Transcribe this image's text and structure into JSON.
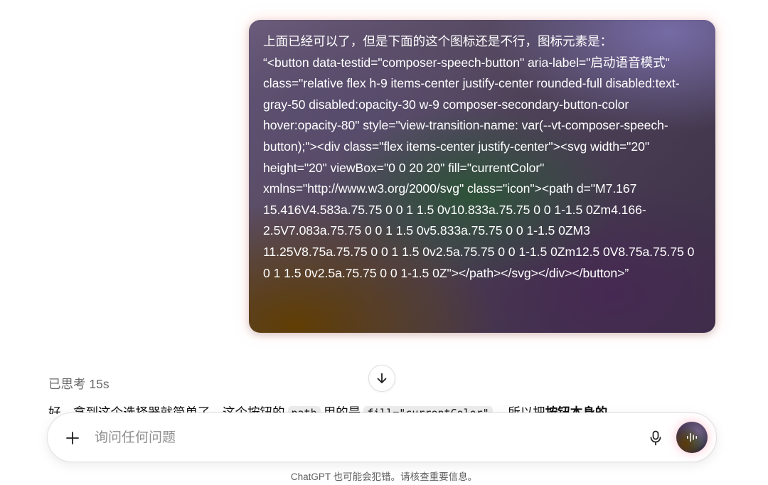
{
  "user_message": {
    "text": "上面已经可以了，但是下面的这个图标还是不行，图标元素是：\n“<button data-testid=\"composer-speech-button\" aria-label=\"启动语音模式\" class=\"relative flex h-9 items-center justify-center rounded-full disabled:text-gray-50 disabled:opacity-30 w-9 composer-secondary-button-color hover:opacity-80\" style=\"view-transition-name: var(--vt-composer-speech-button);\"><div class=\"flex items-center justify-center\"><svg width=\"20\" height=\"20\" viewBox=\"0 0 20 20\" fill=\"currentColor\" xmlns=\"http://www.w3.org/2000/svg\" class=\"icon\"><path d=\"M7.167 15.416V4.583a.75.75 0 0 1 1.5 0v10.833a.75.75 0 0 1-1.5 0Zm4.166-2.5V7.083a.75.75 0 0 1 1.5 0v5.833a.75.75 0 0 1-1.5 0ZM3 11.25V8.75a.75.75 0 0 1 1.5 0v2.5a.75.75 0 0 1-1.5 0Zm12.5 0V8.75a.75.75 0 0 1 1.5 0v2.5a.75.75 0 0 1-1.5 0Z\"></path></svg></div></button>”"
  },
  "assistant": {
    "thought_label": "已思考 15s",
    "reply_parts": {
      "p1": "好，拿到这个选择器就简单了。这个按钮的",
      "code1": "path",
      "p2": "用的是",
      "code2": "fill=\"currentColor\"",
      "p3": "，所以把",
      "bold": "按钮本身的"
    }
  },
  "composer": {
    "placeholder": "询问任何问题"
  },
  "icons": {
    "scroll": "arrow-down-icon",
    "plus": "plus-icon",
    "mic": "microphone-icon",
    "voice": "voice-waveform-icon"
  },
  "colors": {
    "placeholder": "#8e8e8e",
    "bubble_text": "#ffffff",
    "inline_code_bg": "#ececec"
  },
  "footer": {
    "disclaimer": "ChatGPT 也可能会犯错。请核查重要信息。"
  }
}
